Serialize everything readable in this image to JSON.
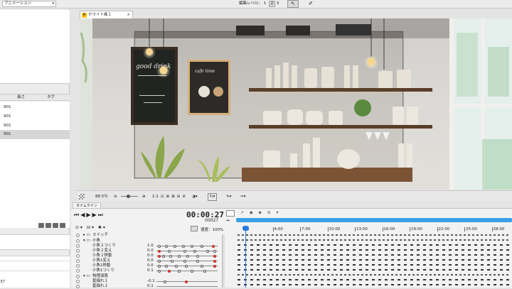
{
  "topbar": {
    "animation_dropdown": "アニメーション",
    "edit_level_label": "編集レベル：",
    "edit_level_values": [
      "1",
      "2",
      "3"
    ]
  },
  "left_panel": {
    "columns": [
      "長さ",
      "タグ"
    ],
    "rows": [
      "901",
      "901",
      "901",
      "901"
    ],
    "bottom_label": "ξ7"
  },
  "document": {
    "tab_title": "ホワイト画１"
  },
  "scene": {
    "chalkboard_text": "good drink",
    "poster_title": "cafe time"
  },
  "view_toolbar": {
    "zoom": "88.5％",
    "ratio": "1:1"
  },
  "timeline": {
    "tab_label": "タイムライン",
    "timecode": "00:00:27",
    "frame": "00027",
    "speed_label": "速度：",
    "speed_value": "100%",
    "tracks": [
      {
        "label": "スイッチ",
        "value": ""
      },
      {
        "label": "小魚",
        "value": ""
      },
      {
        "label": "小魚２つくり",
        "value": "1.0"
      },
      {
        "label": "小魚２変え",
        "value": "0.0"
      },
      {
        "label": "小魚２移動",
        "value": "0.0"
      },
      {
        "label": "小魚1変え",
        "value": "0.0"
      },
      {
        "label": "小魚1移動",
        "value": "0.0"
      },
      {
        "label": "小魚1つくり",
        "value": "0.1"
      },
      {
        "label": "物理演算",
        "value": ""
      },
      {
        "label": "髪揺れ１",
        "value": "-0.1"
      },
      {
        "label": "髪揺れ２",
        "value": "0.1"
      }
    ],
    "ruler_labels": [
      "1",
      "4:00",
      "7:00",
      "10:00",
      "13:00",
      "16:00",
      "19:00",
      "22:00",
      "25:00",
      "28:00"
    ]
  },
  "colors": {
    "accent": "#2a7ae0",
    "keyframe_red": "#e0443c",
    "scrollbar": "#3aa0e8"
  }
}
